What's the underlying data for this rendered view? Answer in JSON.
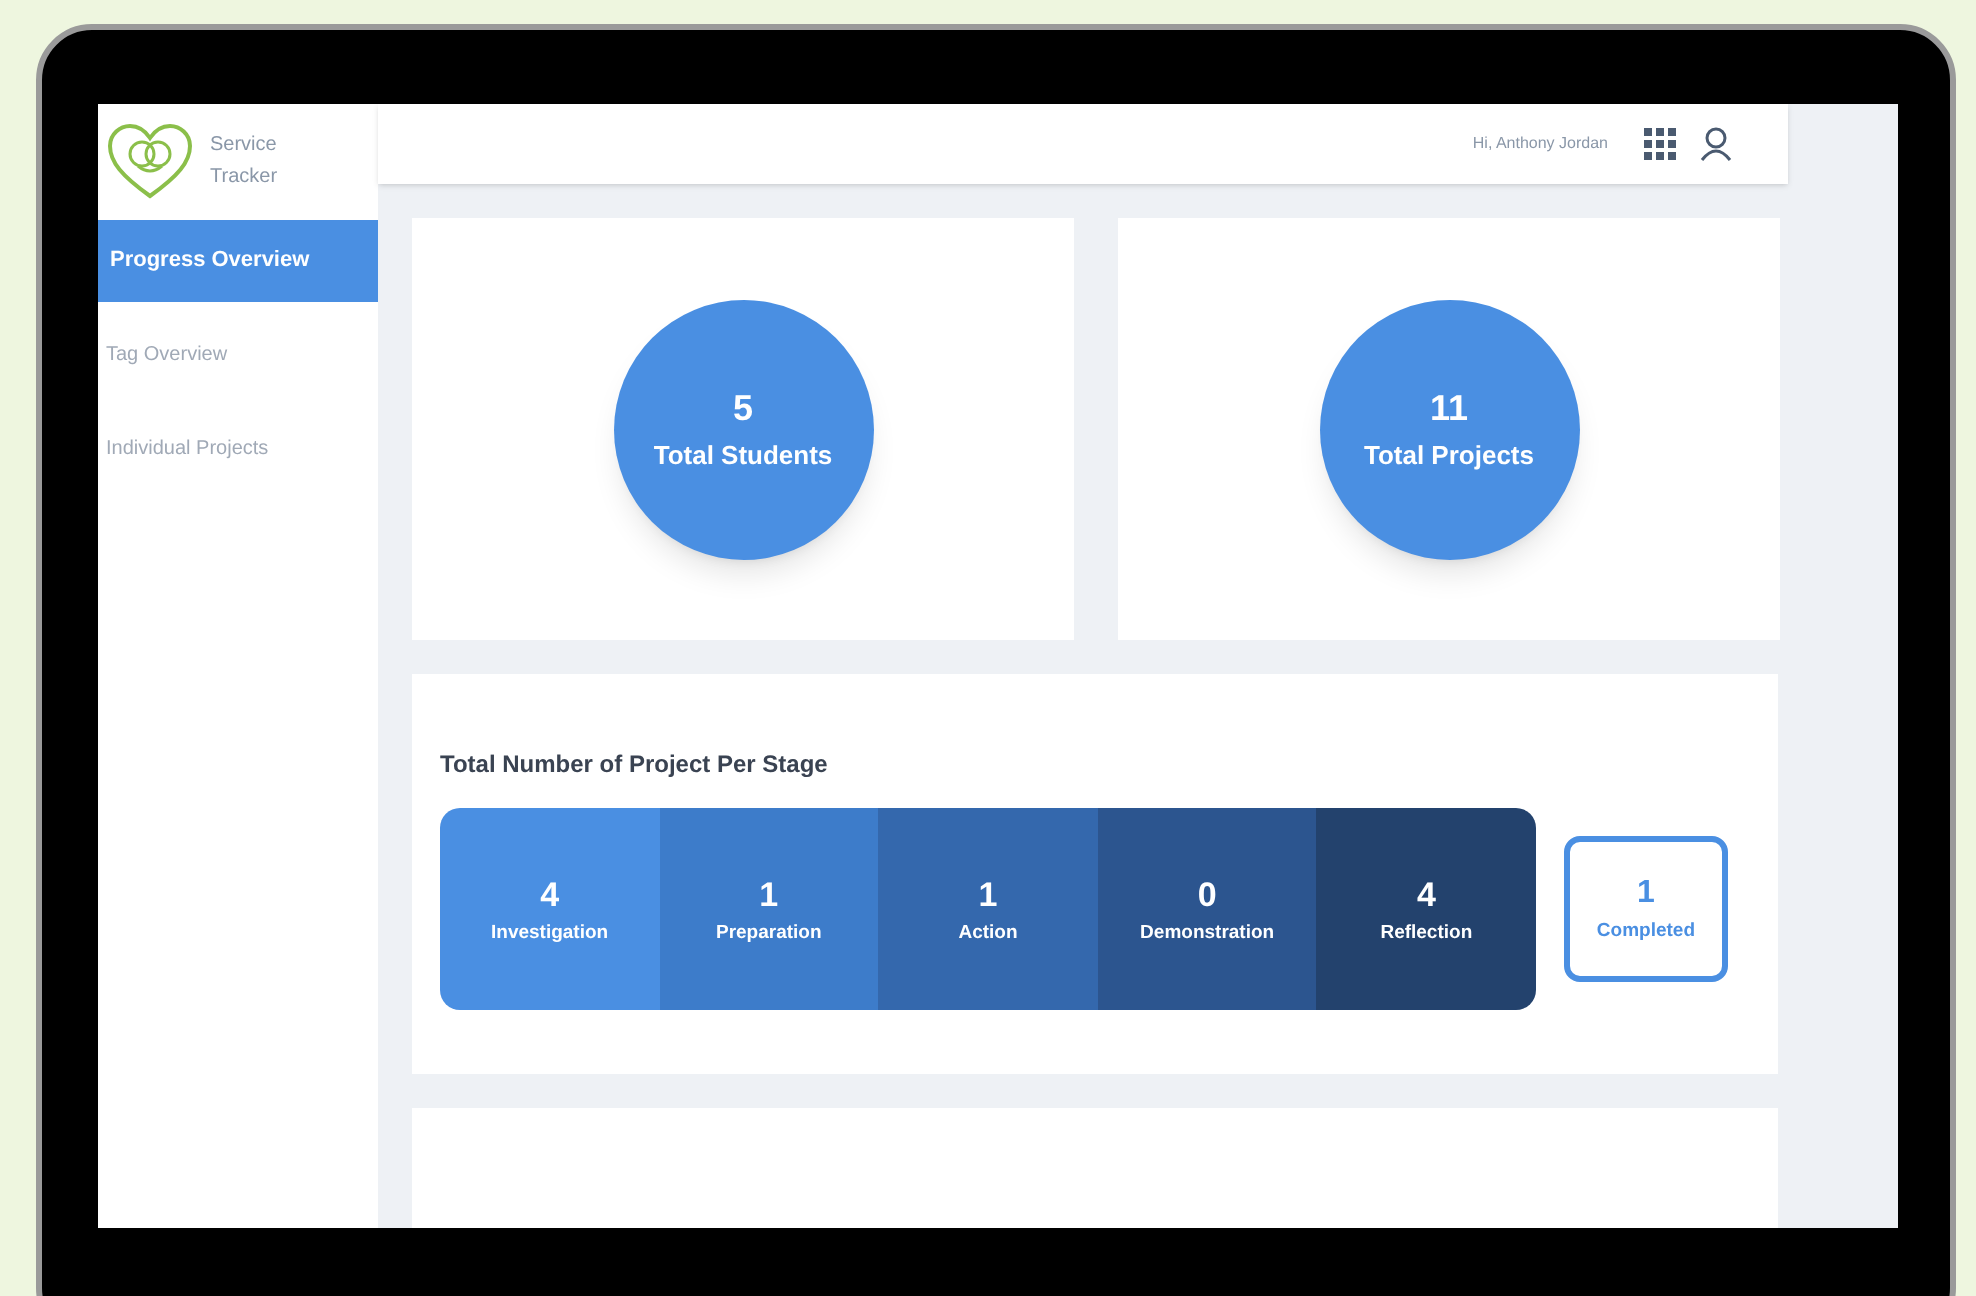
{
  "brand": {
    "name": "Service Tracker"
  },
  "sidebar": {
    "items": [
      {
        "label": "Progress Overview",
        "selected": true
      },
      {
        "label": "Tag Overview",
        "selected": false
      },
      {
        "label": "Individual Projects",
        "selected": false
      }
    ]
  },
  "header": {
    "greeting": "Hi, Anthony Jordan"
  },
  "stats": [
    {
      "value": "5",
      "label": "Total Students"
    },
    {
      "value": "11",
      "label": "Total Projects"
    }
  ],
  "stages_card": {
    "title": "Total Number of Project Per Stage",
    "stages": [
      {
        "value": "4",
        "label": "Investigation",
        "color": "#4a8fe2"
      },
      {
        "value": "1",
        "label": "Preparation",
        "color": "#3d7cca"
      },
      {
        "value": "1",
        "label": "Action",
        "color": "#3468ad"
      },
      {
        "value": "0",
        "label": "Demonstration",
        "color": "#2c558f"
      },
      {
        "value": "4",
        "label": "Reflection",
        "color": "#23426d"
      }
    ],
    "completed": {
      "value": "1",
      "label": "Completed"
    }
  }
}
